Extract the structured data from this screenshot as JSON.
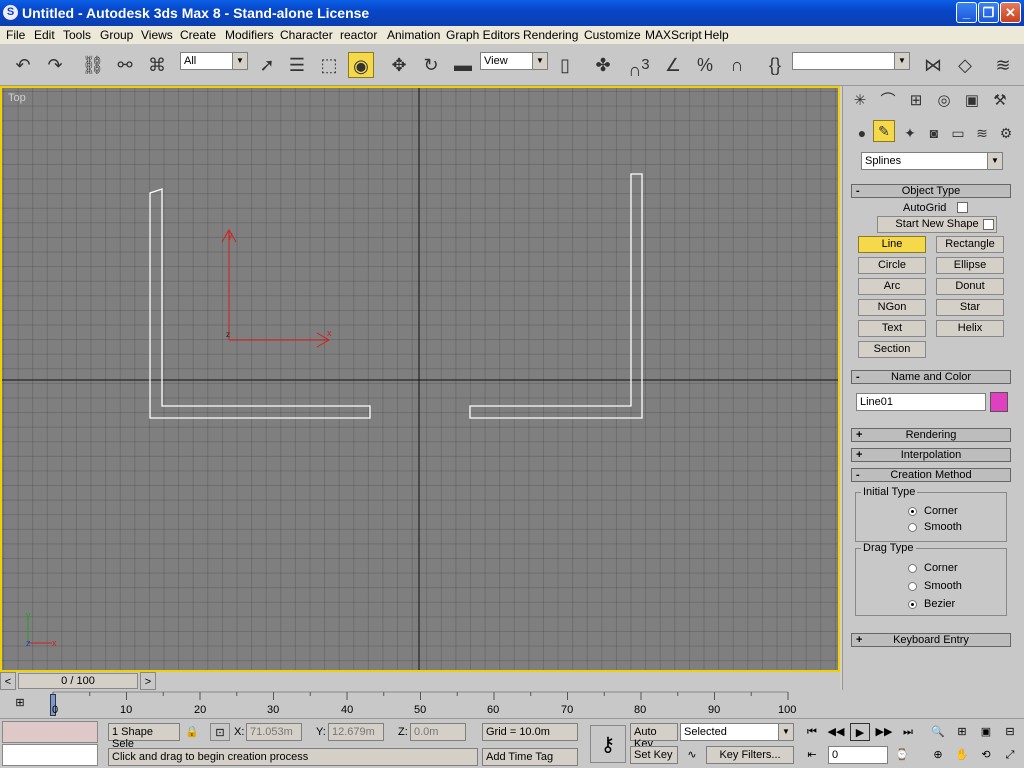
{
  "window": {
    "title": "Untitled - Autodesk 3ds Max 8  - Stand-alone License"
  },
  "menu": [
    "File",
    "Edit",
    "Tools",
    "Group",
    "Views",
    "Create",
    "Modifiers",
    "Character",
    "reactor",
    "Animation",
    "Graph Editors",
    "Rendering",
    "Customize",
    "MAXScript",
    "Help"
  ],
  "toolbar": {
    "selection_filter": "All",
    "reference_coord": "View",
    "named_selection": "",
    "snap_angle_badge": "3"
  },
  "viewport": {
    "label": "Top",
    "gizmo_x": "x",
    "gizmo_y": "y",
    "gizmo_z": "z"
  },
  "command_panel": {
    "category": "Splines",
    "object_type": {
      "header": "Object Type",
      "autogrid": "AutoGrid",
      "start_new_shape": "Start New Shape",
      "buttons": [
        "Line",
        "Rectangle",
        "Circle",
        "Ellipse",
        "Arc",
        "Donut",
        "NGon",
        "Star",
        "Text",
        "Helix",
        "Section"
      ],
      "active": "Line"
    },
    "name_color": {
      "header": "Name and Color",
      "name": "Line01",
      "color": "#e040c0"
    },
    "rendering": "Rendering",
    "interpolation": "Interpolation",
    "creation_method": {
      "header": "Creation Method",
      "initial_type": {
        "label": "Initial Type",
        "options": [
          "Corner",
          "Smooth"
        ],
        "selected": "Corner"
      },
      "drag_type": {
        "label": "Drag Type",
        "options": [
          "Corner",
          "Smooth",
          "Bezier"
        ],
        "selected": "Bezier"
      }
    },
    "keyboard_entry": "Keyboard Entry",
    "collapse_sign": "-",
    "expand_sign": "+"
  },
  "timeline": {
    "frame": "0 / 100",
    "ticks": [
      "0",
      "10",
      "20",
      "30",
      "40",
      "50",
      "60",
      "70",
      "80",
      "90",
      "100"
    ]
  },
  "status": {
    "selection": "1 Shape Sele",
    "prompt": "Click and drag to begin creation process",
    "x_label": "X:",
    "x": "71.053m",
    "y_label": "Y:",
    "y": "12.679m",
    "z_label": "Z:",
    "z": "0.0m",
    "grid": "Grid = 10.0m",
    "add_time_tag": "Add Time Tag",
    "auto_key": "Auto Key",
    "set_key": "Set Key",
    "key_mode": "Selected",
    "key_filters": "Key Filters...",
    "current_frame": "0"
  },
  "colors": {
    "viewport_bg": "#7f7f7f",
    "active_border": "#f0d000",
    "active_button": "#f5d94a",
    "title_bar": "#0846c8"
  }
}
